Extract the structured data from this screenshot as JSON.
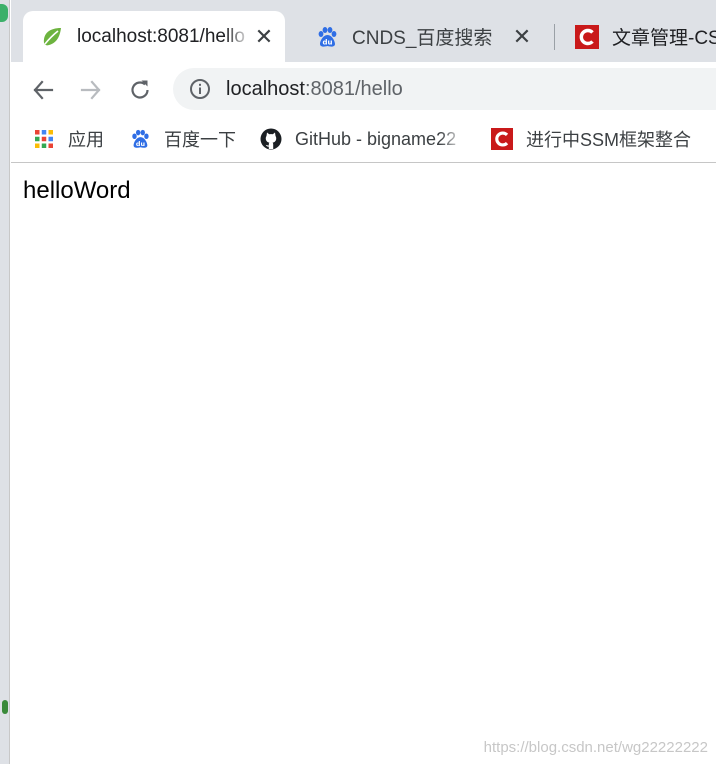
{
  "tabs": [
    {
      "title": "localhost:8081/hello",
      "favicon": "spring-leaf-icon",
      "active": true,
      "close": "✕"
    },
    {
      "title": "CNDS_百度搜索",
      "favicon": "baidu-paw-icon",
      "active": false,
      "close": "✕"
    },
    {
      "title": "文章管理-CSDN",
      "favicon": "csdn-icon",
      "active": false
    }
  ],
  "toolbar": {
    "back": "back-arrow-icon",
    "forward": "forward-arrow-icon",
    "reload": "reload-icon"
  },
  "omnibox": {
    "host": "localhost",
    "rest": ":8081/hello",
    "info_icon": "info-icon"
  },
  "bookmarks": [
    {
      "label": "应用",
      "icon": "apps-grid-icon"
    },
    {
      "label": "百度一下",
      "icon": "baidu-paw-icon"
    },
    {
      "label": "GitHub - bigname22",
      "icon": "github-icon"
    },
    {
      "label": "进行中SSM框架整合",
      "icon": "csdn-icon"
    }
  ],
  "page": {
    "body_text": "helloWord"
  },
  "watermark": "https://blog.csdn.net/wg22222222",
  "colors": {
    "tab_strip": "#dee1e6",
    "omnibox": "#f1f3f4",
    "csdn_red": "#c9191a",
    "baidu_blue": "#2f6ee5",
    "spring_green": "#6db33f"
  }
}
